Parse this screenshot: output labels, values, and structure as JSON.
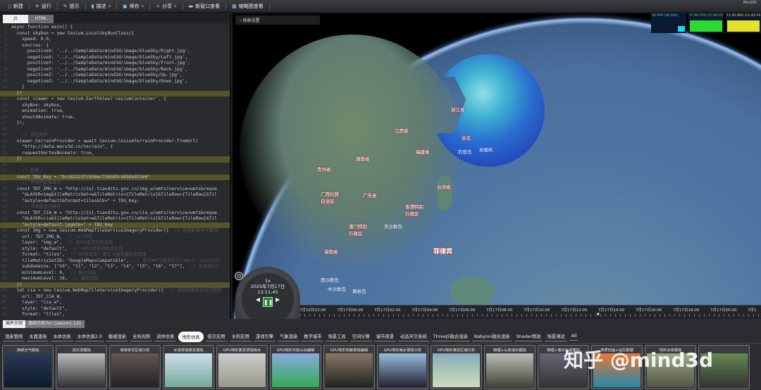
{
  "toolbar": {
    "items": [
      {
        "label": "新建",
        "icon": "file-icon"
      },
      {
        "label": "运行",
        "icon": "run-icon"
      },
      {
        "label": "提示",
        "icon": "hint-icon"
      },
      {
        "label": "描述",
        "icon": "doc-icon",
        "dropdown": true
      },
      {
        "label": "保存",
        "icon": "save-icon",
        "dropdown": true
      },
      {
        "label": "分享",
        "icon": "share-icon",
        "dropdown": true
      },
      {
        "label": "新窗口查看",
        "icon": "window-icon"
      },
      {
        "label": "缩略图查看",
        "icon": "thumbnail-icon"
      }
    ],
    "logo": "Mind3D"
  },
  "editor": {
    "tabs": [
      "JS",
      "HTML"
    ],
    "active_tab": "JS",
    "lines": [
      {
        "t": "async function main() {"
      },
      {
        "t": "  const skybox = new Cesium.LocalSkyBoxClass({"
      },
      {
        "t": "    speed: 0.0,"
      },
      {
        "t": "    sources: {"
      },
      {
        "t": "      positiveX: '../../SampleData/mind3d/image/blueSky/Right.jpg',"
      },
      {
        "t": "      negativeX: '../../SampleData/mind3d/image/blueSky/Left.jpg',"
      },
      {
        "t": "      positiveY: '../../SampleData/mind3d/image/blueSky/Front.jpg',"
      },
      {
        "t": "      negativeY: '../../SampleData/mind3d/image/blueSky/Back.jpg',"
      },
      {
        "t": "      positiveZ: '../../SampleData/mind3d/image/blueSky/Up.jpg',"
      },
      {
        "t": "      negativeZ: '../../SampleData/mind3d/image/blueSky/Down.jpg',"
      },
      {
        "t": "    }"
      },
      {
        "t": "  })",
        "hl": true
      },
      {
        "t": "  const viewer = new Cesium.EarthView('cesiumContainer', {"
      },
      {
        "t": "    skyBox: skybox,"
      },
      {
        "t": "    animation: true,"
      },
      {
        "t": "    shouldAnimate: true,"
      },
      {
        "t": "  });"
      },
      {
        "t": ""
      },
      {
        "t": "",
        "c": "  // 添加地形"
      },
      {
        "t": "  viewer.terrainProvider = await Cesium.CesiumTerrainProvider.fromUrl("
      },
      {
        "t": "    \"http://data.mars3d.cn/terrain\", {"
      },
      {
        "t": "    requestVertexNormals: true,"
      },
      {
        "t": "  })",
        "hl": true
      },
      {
        "t": ""
      },
      {
        "t": "",
        "c": "  // 影像"
      },
      {
        "t": "  const TDU_Key = \"bcc62222fc634ec736589c483de933e6\"",
        "hl": true
      },
      {
        "t": "",
        "c": "  // 天地图影像服务"
      },
      {
        "t": "  const TDT_IMG_W = \"http://{s}.tianditu.gov.cn/img_w/wmts?service=wmts&reque"
      },
      {
        "t": "    \"&LAYER=img&tileMatrixSet=w&TileMatrix={TileMatrix}&TileRow={TileRow}&Til"
      },
      {
        "t": "    \"&style=default&format=tiles&tk=\" + TDU_Key;"
      },
      {
        "t": "",
        "c": "  // 天地图注记服务"
      },
      {
        "t": "  const TDT_CIA_W = \"http://{s}.tianditu.gov.cn/cia_w/wmts?service=wmts&reque"
      },
      {
        "t": "    \"&LAYER=cia&tileMatrixSet=w&TileMatrix={TileMatrix}&TileRow={TileRow}&Til"
      },
      {
        "t": "    \"&style=default.jpg&tk=\" + TDU_Key",
        "hl": true
      },
      {
        "t": "  const Img = new Cesium.WebMapTileServiceImageryProvider({",
        "c": "// 调用影像中文服务"
      },
      {
        "t": "    url: TDT_IMG_W,",
        "c": "// url地址"
      },
      {
        "t": "    layer: \"img_w\",",
        "c": "// WMTS请求的层名称"
      },
      {
        "t": "    style: \"default\",",
        "c": "// WMTS请求的样式名称"
      },
      {
        "t": "    format: \"tiles\",",
        "c": "// MIME类型，用于从服务器检索图像"
      },
      {
        "t": "    tileMatrixSetID: \"GoogleMapsCompatible\",",
        "c": "// 用于WMTS请求的TileMatrixSet的ID"
      },
      {
        "t": "    subdomains: [\"t0\", \"t1\", \"t2\", \"t3\", \"t4\", \"t5\", \"t6\", \"t7\"],",
        "c": "// 天地图8个"
      },
      {
        "t": "    minimumLevel: 0,",
        "c": "// 最小层级"
      },
      {
        "t": "    maximumLevel: 18,",
        "c": "// 最大层级"
      },
      {
        "t": "  })",
        "hl": true
      },
      {
        "t": "  let cia = new Cesium.WebMapTileServiceImageryProvider({",
        "c": "// 调用影像中文注记服务"
      },
      {
        "t": "    url: TDT_CIA_W,"
      },
      {
        "t": "    layer: \"cia_w\","
      },
      {
        "t": "    style: \"default\","
      },
      {
        "t": "    format: \"tiles\","
      }
    ]
  },
  "viewer": {
    "scene_settings": "场景设置",
    "stats": {
      "fps": "56 FPS (36-100)",
      "cpu": "17.00 CPU (17.00-25",
      "gpu": "11.45 GPU (11.45-15",
      "colors": {
        "fps": "#22d3e6",
        "cpu": "#2ed82e",
        "gpu": "#e6e02a"
      }
    },
    "map_labels": [
      "浙江省",
      "江西省",
      "福建省",
      "台湾省",
      "香港特别",
      "行政区",
      "澳门特别",
      "行政区",
      "东沙群岛",
      "广东省",
      "广西壮族",
      "自治区",
      "湖南省",
      "贵州省",
      "海南省",
      "西沙群岛",
      "中沙群岛",
      "黄岩岛",
      "菲律宾",
      "钓鱼岛",
      "赤尾屿",
      "台北"
    ],
    "animation": {
      "speed": "1x",
      "date": "2025年7月17日",
      "time": "13:11:45"
    },
    "timeline": [
      "7月16日22:00",
      "7月17日00:00",
      "7月17日02:00",
      "7月17日04:00",
      "7月17日06:00",
      "7月17日08:00",
      "7月17日10:00",
      "7月17日12:00",
      "7月17日14:00",
      "7月17日16:00",
      "7月17日18:00",
      "7月17日20:00",
      "7月1"
    ]
  },
  "bottom": {
    "tabs": [
      "插件示例",
      "基础示例 for Cesium1.131"
    ],
    "active_tab": "插件示例",
    "categories": [
      "渲染管线",
      "水面渲染",
      "水体仿真",
      "水体仿真2.0",
      "植被渲染",
      "全局光照",
      "流体仿真",
      "地形仿真",
      "低空应用",
      "水利应用",
      "游戏引擎",
      "气象渲染",
      "数字城市",
      "场景工具",
      "空间计算",
      "城市夜景",
      "动态天空系统",
      "ThreeJS融合渲染",
      "Babylon融合渲染",
      "Shader特效",
      "场景测试",
      "All"
    ],
    "active_category": "地形仿真",
    "thumbnails": [
      "滑坡天气模拟",
      "泥石流模拟",
      "滑坡受灾区域分析",
      "水流侵蚀蒸发模拟",
      "GPU地形蒸发侵蚀雨水",
      "GPU地形河道山谷编辑",
      "GPU地形地貌侵蚀编辑",
      "GPU地形雨水侵蚀分析",
      "GPU地形淹没区域分析",
      "物理+山体滚石模拟",
      "物理+落石轨迹模拟",
      "地质剖面+钻孔数据",
      "地形水体模拟",
      ""
    ]
  },
  "watermark": "知乎 @mind3d"
}
